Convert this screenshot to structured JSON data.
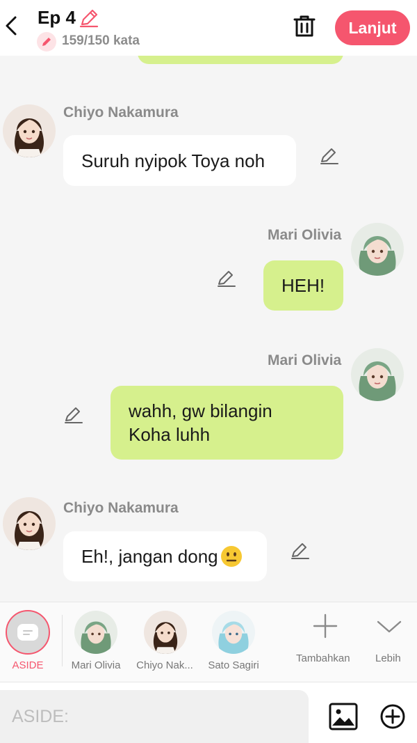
{
  "header": {
    "episode_title": "Ep 4",
    "word_count": "159/150 kata",
    "next_label": "Lanjut"
  },
  "messages": [
    {
      "sender": "Chiyo Nakamura",
      "text": "Suruh nyipok Toya noh"
    },
    {
      "sender": "Mari Olivia",
      "text": "HEH!"
    },
    {
      "sender": "Mari Olivia",
      "text": "wahh, gw bilangin Koha luhh"
    },
    {
      "sender": "Chiyo Nakamura",
      "text": "Eh!, jangan dong"
    }
  ],
  "character_bar": {
    "aside_label": "ASIDE",
    "characters": [
      {
        "name": "Mari Olivia"
      },
      {
        "name": "Chiyo Nak..."
      },
      {
        "name": "Sato Sagiri"
      }
    ],
    "add_label": "Tambahkan",
    "more_label": "Lebih"
  },
  "input": {
    "placeholder": "ASIDE:"
  },
  "colors": {
    "accent": "#f5566e",
    "green_bubble": "#d6f08d",
    "white_bubble": "#ffffff",
    "background": "#f5f5f5"
  }
}
